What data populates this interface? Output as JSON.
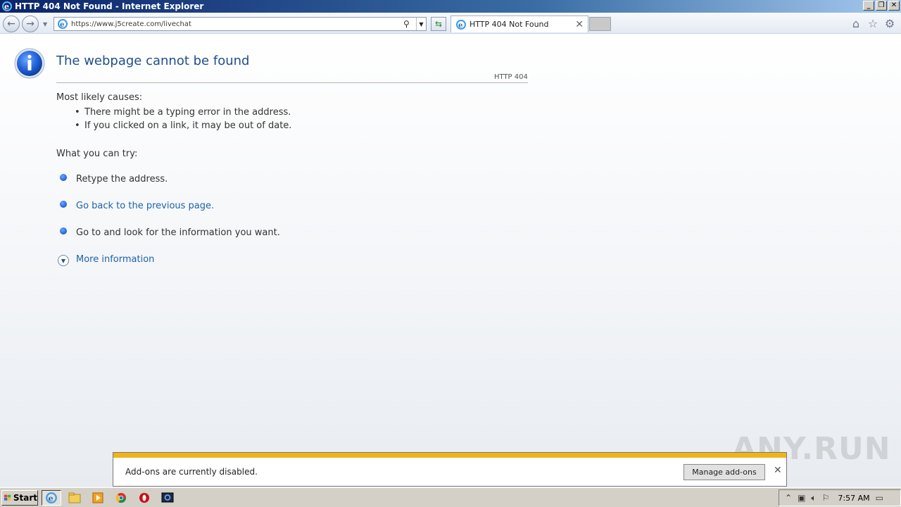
{
  "window": {
    "title": "HTTP 404 Not Found - Internet Explorer",
    "minimize": "_",
    "restore": "❐",
    "close": "✕"
  },
  "navbar": {
    "url": "https://www.j5create.com/livechat",
    "tab_label": "HTTP 404 Not Found"
  },
  "page": {
    "title": "The webpage cannot be found",
    "code": "HTTP 404",
    "causes_heading": "Most likely causes:",
    "causes": [
      "There might be a typing error in the address.",
      "If you clicked on a link, it may be out of date."
    ],
    "try_heading": "What you can try:",
    "try_items": [
      "Retype the address.",
      "Go back to the previous page.",
      "Go to  and look for the information you want."
    ],
    "more_info": "More information"
  },
  "notification": {
    "message": "Add-ons are currently disabled.",
    "button": "Manage add-ons"
  },
  "taskbar": {
    "start": "Start",
    "clock": "7:57 AM"
  },
  "watermark": "ANY.RUN"
}
